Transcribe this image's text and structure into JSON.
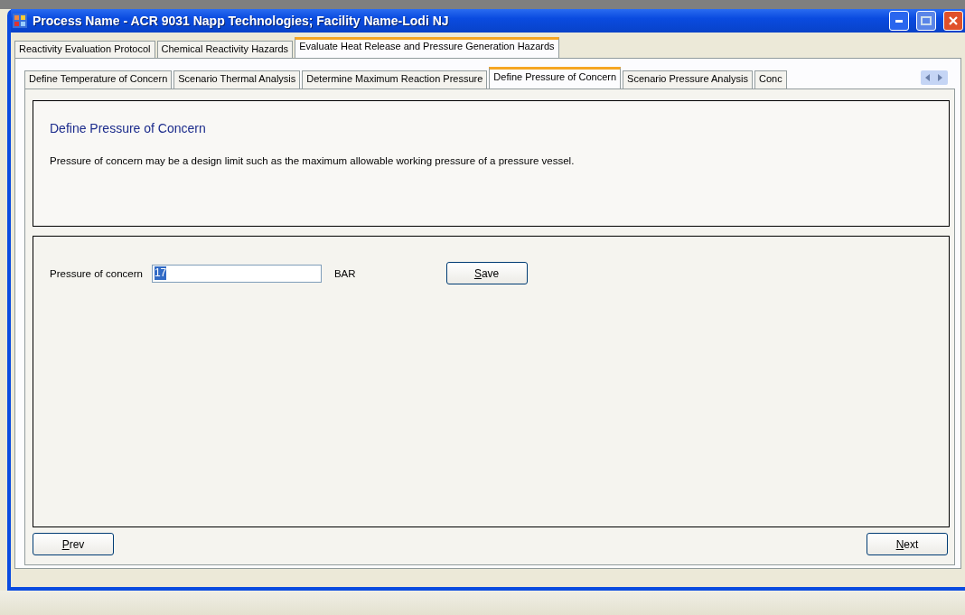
{
  "window": {
    "title": "Process Name - ACR 9031 Napp Technologies; Facility Name-Lodi NJ"
  },
  "tabs": [
    {
      "label": "Reactivity Evaluation Protocol",
      "selected": false
    },
    {
      "label": "Chemical Reactivity Hazards",
      "selected": false
    },
    {
      "label": "Evaluate Heat Release and Pressure Generation Hazards",
      "selected": true
    }
  ],
  "subtabs": [
    {
      "label": "Define Temperature of Concern",
      "selected": false
    },
    {
      "label": "Scenario Thermal Analysis",
      "selected": false
    },
    {
      "label": "Determine Maximum Reaction Pressure",
      "selected": false
    },
    {
      "label": "Define Pressure of Concern",
      "selected": true
    },
    {
      "label": "Scenario Pressure Analysis",
      "selected": false
    },
    {
      "label": "Conc",
      "selected": false
    }
  ],
  "info": {
    "heading": "Define Pressure of Concern",
    "text": "Pressure of concern may be a design limit such as the maximum allowable working pressure of a pressure vessel."
  },
  "form": {
    "label": "Pressure of concern",
    "value": "17",
    "unit": "BAR",
    "save_button": {
      "label": "Save",
      "underline_first": true
    }
  },
  "nav": {
    "prev": {
      "label": "Prev",
      "underline_first": true
    },
    "next": {
      "label": "Next",
      "underline_first": true
    }
  }
}
